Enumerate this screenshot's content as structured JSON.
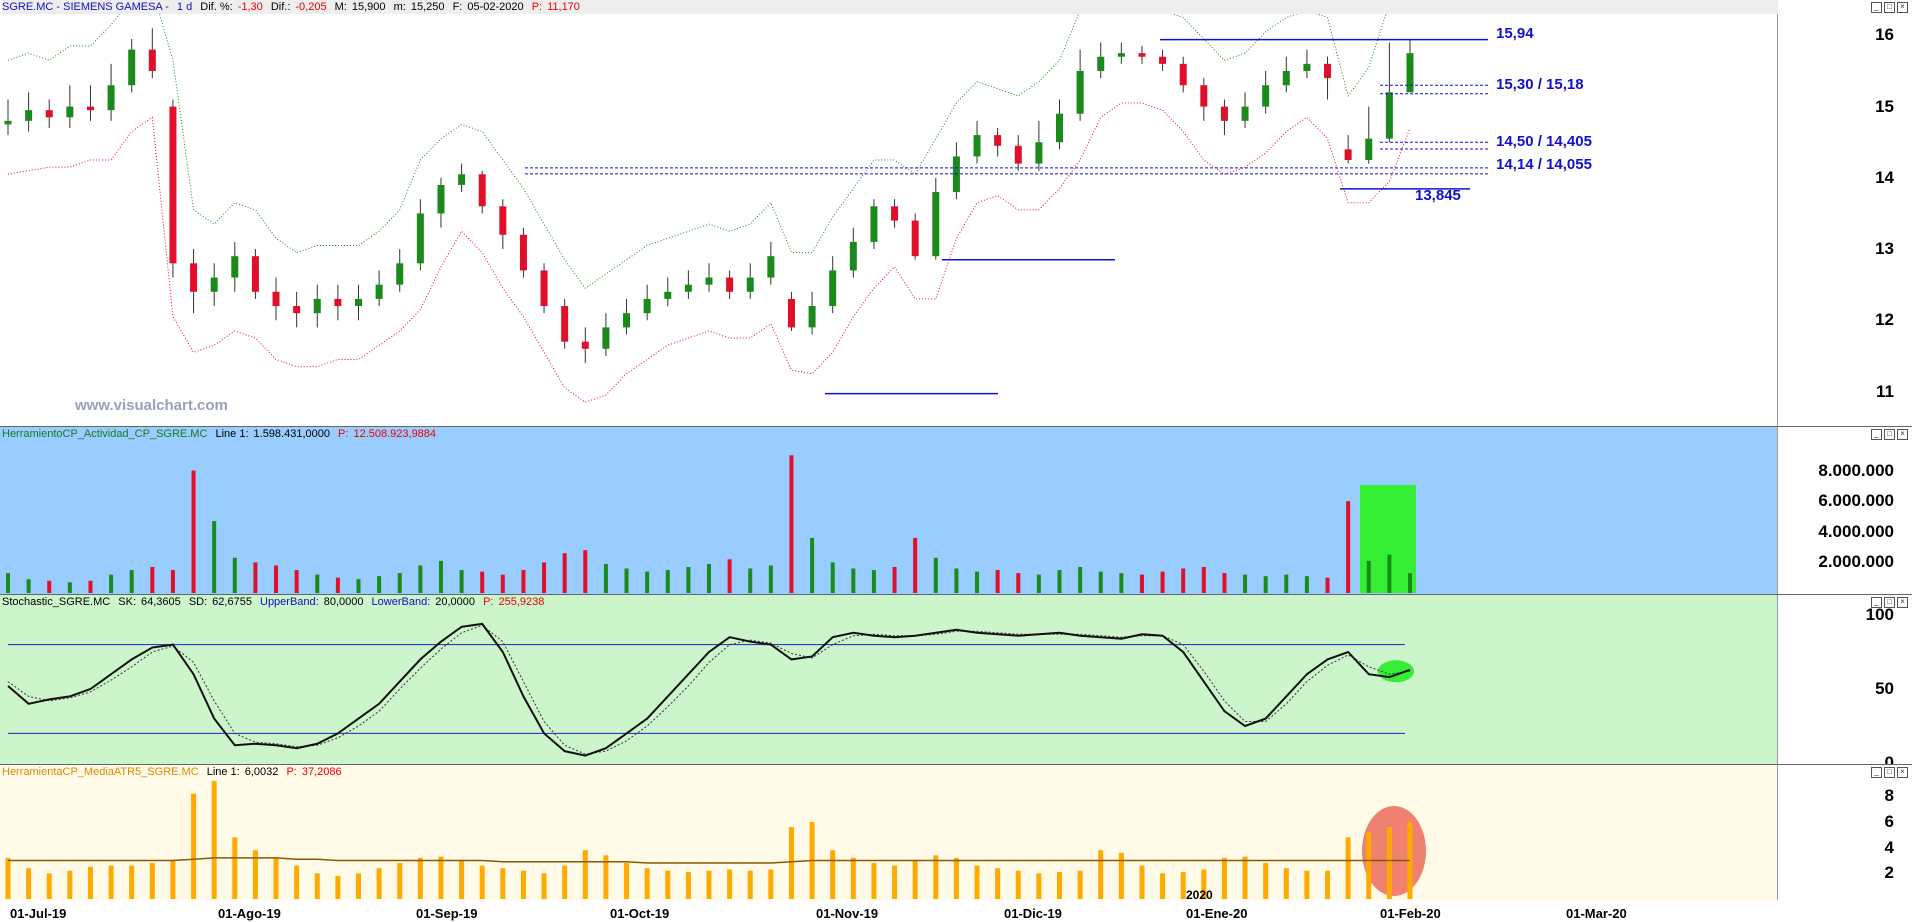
{
  "panels": {
    "price": {
      "symbol": "SGRE.MC - SIEMENS GAMESA -",
      "timeframe": "1 d",
      "dif_pct_label": "Dif. %:",
      "dif_pct": "-1,30",
      "dif_label": "Dif.:",
      "dif": "-0,205",
      "max_label": "M:",
      "max": "15,900",
      "min_label": "m:",
      "min": "15,250",
      "date_label": "F:",
      "date": "05-02-2020",
      "last_label": "P:",
      "last": "11,170",
      "watermark": "www.visualchart.com",
      "levels": {
        "r1": "15,94",
        "r2": "15,30 / 15,18",
        "r3": "14,50 / 14,405",
        "r4": "14,14 / 14,055",
        "s1": "13,845"
      }
    },
    "volume": {
      "name": "HerramientoCP_Actividad_CP_SGRE.MC",
      "line_label": "Line 1:",
      "line_value": "1.598.431,0000",
      "p_label": "P:",
      "p_value": "12.508.923,9884"
    },
    "stochastic": {
      "name": "Stochastic_SGRE.MC",
      "sk_label": "SK:",
      "sk": "64,3605",
      "sd_label": "SD:",
      "sd": "62,6755",
      "ub_label": "UpperBand:",
      "ub": "80,0000",
      "lb_label": "LowerBand:",
      "lb": "20,0000",
      "p_label": "P:",
      "p_value": "255,9238"
    },
    "atr": {
      "name": "HerramientaCP_MediaATR5_SGRE.MC",
      "line_label": "Line 1:",
      "line_value": "6,0032",
      "p_label": "P:",
      "p_value": "37,2086"
    }
  },
  "x_axis": {
    "labels": [
      "01-Jul-19",
      "01-Ago-19",
      "01-Sep-19",
      "01-Oct-19",
      "01-Nov-19",
      "01-Dic-19",
      "01-Ene-20",
      "01-Feb-20",
      "01-Mar-20"
    ],
    "year_marker": "2020"
  },
  "chart_data": [
    {
      "type": "candlestick",
      "title": "SGRE.MC - SIEMENS GAMESA",
      "x": [
        "01-Jul-19",
        "01-Ago-19",
        "01-Sep-19",
        "01-Oct-19",
        "01-Nov-19",
        "01-Dic-19",
        "01-Ene-20",
        "01-Feb-20",
        "01-Mar-20"
      ],
      "ylim": [
        10.6,
        16.3
      ],
      "yticks": [
        11,
        12,
        13,
        14,
        15,
        16
      ],
      "close": [
        14.8,
        14.95,
        14.85,
        15.0,
        14.95,
        15.3,
        15.8,
        15.5,
        12.8,
        12.4,
        12.6,
        12.9,
        12.4,
        12.2,
        12.1,
        12.3,
        12.2,
        12.3,
        12.5,
        12.8,
        13.5,
        13.9,
        14.05,
        13.6,
        13.2,
        12.7,
        12.2,
        11.7,
        11.6,
        11.9,
        12.1,
        12.3,
        12.4,
        12.5,
        12.6,
        12.4,
        12.6,
        12.9,
        11.9,
        12.2,
        12.7,
        13.1,
        13.6,
        13.4,
        12.9,
        13.8,
        14.3,
        14.6,
        14.45,
        14.2,
        14.5,
        14.9,
        15.5,
        15.7,
        15.75,
        15.7,
        15.6,
        15.3,
        15.0,
        14.8,
        15.0,
        15.3,
        15.5,
        15.6,
        15.4,
        14.25,
        14.55,
        15.2,
        15.75
      ],
      "open": [
        14.75,
        14.8,
        14.95,
        14.85,
        15.0,
        14.95,
        15.3,
        15.8,
        15.0,
        12.8,
        12.4,
        12.6,
        12.9,
        12.4,
        12.2,
        12.1,
        12.3,
        12.2,
        12.3,
        12.5,
        12.8,
        13.5,
        13.9,
        14.05,
        13.6,
        13.2,
        12.7,
        12.2,
        11.7,
        11.6,
        11.9,
        12.1,
        12.3,
        12.4,
        12.5,
        12.6,
        12.4,
        12.6,
        12.3,
        11.9,
        12.2,
        12.7,
        13.1,
        13.6,
        13.4,
        12.9,
        13.8,
        14.3,
        14.6,
        14.45,
        14.2,
        14.5,
        14.9,
        15.5,
        15.7,
        15.75,
        15.7,
        15.6,
        15.3,
        15.0,
        14.8,
        15.0,
        15.3,
        15.5,
        15.6,
        14.4,
        14.25,
        14.55,
        15.2
      ],
      "high": [
        15.1,
        15.2,
        15.1,
        15.3,
        15.3,
        15.6,
        15.95,
        16.1,
        15.1,
        13.0,
        12.8,
        13.1,
        13.0,
        12.6,
        12.4,
        12.5,
        12.5,
        12.5,
        12.7,
        13.0,
        13.7,
        14.0,
        14.2,
        14.1,
        13.7,
        13.3,
        12.8,
        12.3,
        11.9,
        12.1,
        12.3,
        12.5,
        12.6,
        12.7,
        12.8,
        12.7,
        12.8,
        13.1,
        12.4,
        12.4,
        12.9,
        13.3,
        13.7,
        13.7,
        13.5,
        14.0,
        14.5,
        14.8,
        14.7,
        14.6,
        14.8,
        15.1,
        15.8,
        15.9,
        15.9,
        15.85,
        15.8,
        15.7,
        15.4,
        15.1,
        15.2,
        15.5,
        15.7,
        15.8,
        15.7,
        14.6,
        15.0,
        15.9,
        15.94
      ],
      "low": [
        14.6,
        14.65,
        14.7,
        14.7,
        14.8,
        14.8,
        15.2,
        15.4,
        12.6,
        12.1,
        12.2,
        12.4,
        12.3,
        12.0,
        11.9,
        11.9,
        12.0,
        12.0,
        12.2,
        12.4,
        12.7,
        13.3,
        13.8,
        13.5,
        13.0,
        12.6,
        12.1,
        11.6,
        11.4,
        11.5,
        11.8,
        12.0,
        12.2,
        12.3,
        12.4,
        12.3,
        12.3,
        12.5,
        11.85,
        11.8,
        12.1,
        12.6,
        13.0,
        13.3,
        12.85,
        12.85,
        13.7,
        14.2,
        14.3,
        14.1,
        14.1,
        14.4,
        14.8,
        15.4,
        15.6,
        15.6,
        15.5,
        15.2,
        14.8,
        14.6,
        14.7,
        14.9,
        15.2,
        15.4,
        15.1,
        14.2,
        14.2,
        14.5,
        15.25
      ]
    },
    {
      "type": "bar",
      "title": "HerramientoCP_Actividad_CP_SGRE.MC",
      "yticks": [
        "2.000.000",
        "4.000.000",
        "6.000.000",
        "8.000.000"
      ],
      "ylim": [
        0,
        9800000
      ],
      "values": [
        1300000,
        900000,
        800000,
        700000,
        800000,
        1200000,
        1500000,
        1700000,
        1500000,
        8000000,
        4700000,
        2300000,
        2000000,
        1800000,
        1500000,
        1200000,
        1000000,
        900000,
        1100000,
        1300000,
        1800000,
        2100000,
        1500000,
        1400000,
        1200000,
        1500000,
        2000000,
        2600000,
        2800000,
        1900000,
        1600000,
        1400000,
        1500000,
        1700000,
        1900000,
        2200000,
        1600000,
        1800000,
        9000000,
        3600000,
        2000000,
        1600000,
        1500000,
        1700000,
        3600000,
        2300000,
        1600000,
        1400000,
        1500000,
        1300000,
        1200000,
        1500000,
        1700000,
        1400000,
        1300000,
        1200000,
        1400000,
        1600000,
        1700000,
        1300000,
        1200000,
        1100000,
        1200000,
        1100000,
        1000000,
        6000000,
        2100000,
        2500000,
        1300000
      ],
      "colors_up_down": {
        "up": "#1a8a1a",
        "down": "#e0102a"
      }
    },
    {
      "type": "line",
      "title": "Stochastic_SGRE.MC",
      "ylim": [
        0,
        100
      ],
      "yticks": [
        0,
        50,
        100
      ],
      "upper_band": 80,
      "lower_band": 20,
      "series": [
        {
          "name": "SK",
          "values": [
            52,
            40,
            43,
            45,
            50,
            60,
            70,
            78,
            80,
            60,
            30,
            12,
            13,
            12,
            10,
            13,
            20,
            30,
            40,
            55,
            70,
            82,
            92,
            94,
            75,
            45,
            20,
            8,
            5,
            10,
            20,
            30,
            45,
            60,
            75,
            85,
            82,
            80,
            70,
            72,
            85,
            88,
            86,
            85,
            86,
            88,
            90,
            88,
            87,
            86,
            87,
            88,
            86,
            85,
            84,
            87,
            86,
            75,
            55,
            35,
            25,
            30,
            45,
            60,
            70,
            75,
            60,
            58,
            63
          ]
        },
        {
          "name": "SD",
          "values": [
            55,
            45,
            42,
            44,
            48,
            56,
            65,
            75,
            79,
            68,
            42,
            20,
            14,
            13,
            11,
            12,
            17,
            25,
            35,
            50,
            64,
            77,
            88,
            93,
            82,
            55,
            28,
            12,
            6,
            8,
            15,
            25,
            38,
            52,
            68,
            80,
            83,
            81,
            74,
            71,
            80,
            86,
            87,
            86,
            86,
            87,
            89,
            89,
            88,
            87,
            87,
            87,
            87,
            86,
            85,
            86,
            86,
            80,
            62,
            42,
            28,
            28,
            40,
            55,
            66,
            73,
            65,
            60,
            62
          ]
        }
      ]
    },
    {
      "type": "bar",
      "title": "HerramientaCP_MediaATR5_SGRE.MC",
      "ylim": [
        0,
        9.5
      ],
      "yticks": [
        2,
        4,
        6,
        8
      ],
      "values": [
        3.2,
        2.4,
        2.0,
        2.2,
        2.5,
        2.6,
        2.6,
        2.8,
        3.0,
        8.2,
        9.2,
        4.8,
        3.8,
        3.2,
        2.6,
        2.0,
        1.8,
        2.0,
        2.4,
        2.8,
        3.2,
        3.3,
        3.0,
        2.6,
        2.4,
        2.2,
        2.0,
        2.6,
        3.8,
        3.4,
        2.8,
        2.4,
        2.2,
        2.1,
        2.2,
        2.3,
        2.2,
        2.3,
        5.6,
        6.0,
        3.8,
        3.2,
        2.8,
        2.6,
        3.0,
        3.4,
        3.2,
        2.6,
        2.4,
        2.2,
        2.0,
        2.1,
        2.2,
        3.8,
        3.6,
        2.6,
        2.0,
        2.1,
        2.3,
        3.2,
        3.3,
        2.8,
        2.4,
        2.2,
        2.2,
        4.8,
        5.2,
        5.6,
        6.0
      ],
      "series": [
        {
          "name": "Line 1",
          "values": [
            3.0,
            3.0,
            3.0,
            3.0,
            3.0,
            3.0,
            3.0,
            3.0,
            3.0,
            3.1,
            3.2,
            3.2,
            3.2,
            3.2,
            3.1,
            3.1,
            3.0,
            3.0,
            3.0,
            3.0,
            3.0,
            3.0,
            3.0,
            3.0,
            2.9,
            2.9,
            2.9,
            2.9,
            2.9,
            2.9,
            2.9,
            2.8,
            2.8,
            2.8,
            2.8,
            2.8,
            2.8,
            2.8,
            2.9,
            3.0,
            3.0,
            3.0,
            3.0,
            3.0,
            3.0,
            3.0,
            3.0,
            3.0,
            3.0,
            3.0,
            3.0,
            3.0,
            3.0,
            3.0,
            3.0,
            3.0,
            3.0,
            3.0,
            3.0,
            3.0,
            3.0,
            3.0,
            3.0,
            3.0,
            3.0,
            3.0,
            3.0,
            3.0,
            3.0
          ]
        }
      ]
    }
  ],
  "colors": {
    "up": "#1a8a1a",
    "down": "#e0102a",
    "neutral": "#1020d0",
    "band_upper": "#1a8a1a",
    "band_lower": "#e0102a",
    "level_line": "#1010d0",
    "stoch_bg": "#ccf5cc",
    "vol_bg": "#99ccff",
    "atr_bg": "#fffbe8",
    "atr_bar": "#ffaa00"
  }
}
